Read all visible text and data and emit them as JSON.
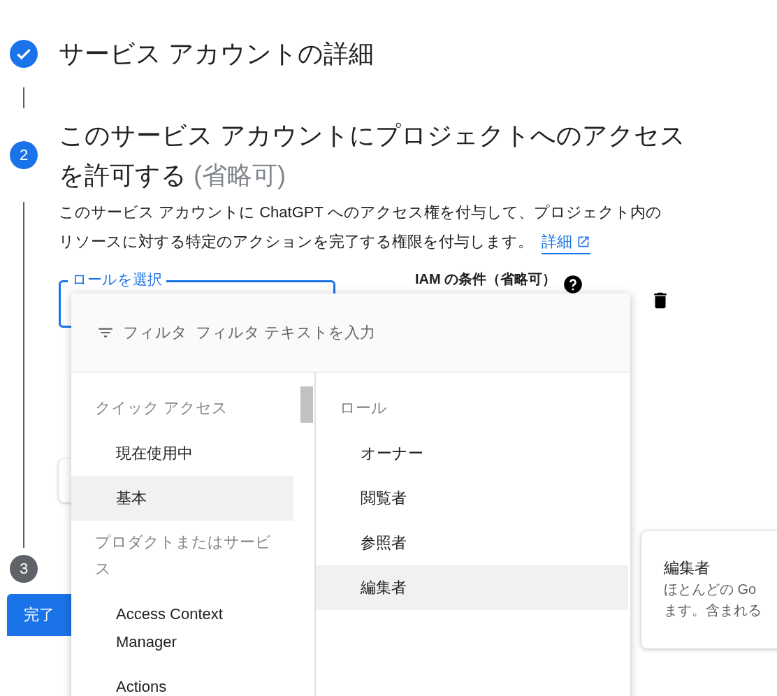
{
  "steps": [
    {
      "completed": true,
      "title": "サービス アカウントの詳細"
    },
    {
      "completed": false,
      "current": true,
      "number": "2",
      "title": "このサービス アカウントにプロジェクトへのアクセスを許可する",
      "optional": "(省略可)"
    },
    {
      "completed": false,
      "current": false,
      "number": "3"
    }
  ],
  "description": {
    "text": "このサービス アカウントに ChatGPT へのアクセス権を付与して、プロジェクト内のリソースに対する特定のアクションを完了する権限を付与します。",
    "link": "詳細"
  },
  "role_field": {
    "label": "ロールを選択"
  },
  "condition": {
    "label": "IAM の条件（省略可）"
  },
  "role_menu": {
    "filter_label": "フィルタ",
    "filter_placeholder": "フィルタ テキストを入力",
    "categories": [
      {
        "kind": "header",
        "label": "クイック アクセス"
      },
      {
        "kind": "item",
        "label": "現在使用中",
        "selected": false
      },
      {
        "kind": "item",
        "label": "基本",
        "selected": true
      },
      {
        "kind": "header",
        "label": "プロダクトまたはサービス"
      },
      {
        "kind": "item",
        "label": "Access Context Manager",
        "selected": false
      },
      {
        "kind": "item",
        "label": "Actions",
        "selected": false
      }
    ],
    "roles_header": "ロール",
    "roles": [
      {
        "label": "オーナー",
        "selected": false
      },
      {
        "label": "閲覧者",
        "selected": false
      },
      {
        "label": "参照者",
        "selected": false
      },
      {
        "label": "編集者",
        "selected": true
      }
    ]
  },
  "tooltip": {
    "title": "編集者",
    "lines": [
      "ほとんどの Go",
      "ます。含まれる"
    ]
  },
  "done_button": "完了"
}
